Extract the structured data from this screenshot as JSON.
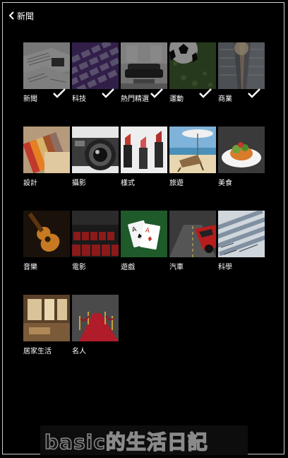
{
  "header": {
    "back_label": "新聞"
  },
  "categories": [
    {
      "label": "新聞",
      "image": "newspapers",
      "selected": true
    },
    {
      "label": "科技",
      "image": "tech-keyboard",
      "selected": true
    },
    {
      "label": "熱門精選",
      "image": "living-room",
      "selected": true
    },
    {
      "label": "運動",
      "image": "soccer-ball",
      "selected": true
    },
    {
      "label": "商業",
      "image": "skyscrapers",
      "selected": true
    },
    {
      "label": "設計",
      "image": "color-swatches",
      "selected": false
    },
    {
      "label": "攝影",
      "image": "camera-lens",
      "selected": false
    },
    {
      "label": "樣式",
      "image": "lipsticks",
      "selected": false
    },
    {
      "label": "旅遊",
      "image": "beach-chair",
      "selected": false
    },
    {
      "label": "美食",
      "image": "food-dish",
      "selected": false
    },
    {
      "label": "音樂",
      "image": "guitar",
      "selected": false
    },
    {
      "label": "電影",
      "image": "cinema-seats",
      "selected": false
    },
    {
      "label": "遊戲",
      "image": "playing-cards",
      "selected": false
    },
    {
      "label": "汽車",
      "image": "red-car",
      "selected": false
    },
    {
      "label": "科學",
      "image": "science-formulas",
      "selected": false
    },
    {
      "label": "居家生活",
      "image": "home-interior",
      "selected": false
    },
    {
      "label": "名人",
      "image": "red-carpet",
      "selected": false
    }
  ],
  "watermark": {
    "text": "basic的生活日記"
  }
}
